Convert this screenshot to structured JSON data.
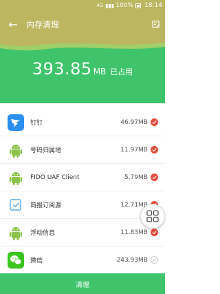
{
  "status": {
    "signal": "4G",
    "battery": "100%",
    "time": "18:14"
  },
  "appbar": {
    "title": "内存清理"
  },
  "header": {
    "value": "393.85",
    "unit": "MB",
    "label": "已占用"
  },
  "apps": [
    {
      "name": "钉钉",
      "size": "46.97MB",
      "checked": true,
      "icon": "dingtalk-icon"
    },
    {
      "name": "号码归属地",
      "size": "11.97MB",
      "checked": true,
      "icon": "android-icon"
    },
    {
      "name": "FIDO UAF Client",
      "size": "5.79MB",
      "checked": true,
      "icon": "android-icon"
    },
    {
      "name": "简报订阅源",
      "size": "12.71MB",
      "checked": true,
      "icon": "briefing-icon"
    },
    {
      "name": "浮动信息",
      "size": "11.83MB",
      "checked": true,
      "icon": "android-icon"
    },
    {
      "name": "微信",
      "size": "243.93MB",
      "checked": false,
      "icon": "wechat-icon"
    }
  ],
  "bottom": {
    "clean_label": "清理"
  },
  "colors": {
    "toolbar": "#bcb660",
    "accent": "#3fc46c",
    "check": "#e74c3c"
  }
}
